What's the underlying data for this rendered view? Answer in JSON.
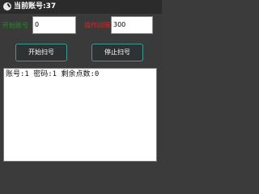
{
  "window": {
    "title": "当前账号:37"
  },
  "form": {
    "start_label": "开始账号",
    "start_value": "0",
    "delay_label": "操作间隔",
    "delay_value": "300"
  },
  "buttons": {
    "start_label": "开始扫号",
    "stop_label": "停止扫号"
  },
  "log": {
    "text": "账号:1 密码:1 剩余点数:0"
  },
  "colors": {
    "start_label": "#1f8f25",
    "delay_label": "#e02020",
    "button_border": "#3e9c8e"
  }
}
